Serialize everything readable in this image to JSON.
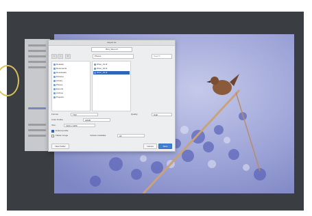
{
  "dialog": {
    "title": "Export As",
    "filename": "Bird_Wren.tif",
    "location": "Photos",
    "search_placeholder": "Search",
    "nav": {
      "back": "<",
      "forward": ">",
      "view": "≡"
    },
    "sidebar_items": [
      "Desktop",
      "Documents",
      "Downloads",
      "Pictures",
      "Library",
      "Photos",
      "Exports",
      "Archive",
      "Projects"
    ],
    "files": [
      "Wren_01.tif",
      "Wren_02.tif",
      "Wren_03.tif"
    ],
    "selected_file_index": 2,
    "options": {
      "format_label": "Format:",
      "format_value": "TIFF",
      "quality_label": "Quality:",
      "quality_value": "High",
      "color_label": "Color Profile:",
      "color_value": "sRGB",
      "size_label": "Size:",
      "size_value": "1920 x 1280",
      "embed_label": "Embed profile",
      "layers_label": "Flatten image",
      "metadata_label": "Include metadata:",
      "metadata_value": "All"
    },
    "buttons": {
      "new_folder": "New Folder",
      "cancel": "Cancel",
      "save": "Save"
    }
  },
  "colors": {
    "workspace": "#3a3d42",
    "accent": "#3f7fd4",
    "selection": "#2f64b8"
  },
  "icons": [
    "folder-icon",
    "back-icon",
    "forward-icon",
    "view-icon"
  ]
}
